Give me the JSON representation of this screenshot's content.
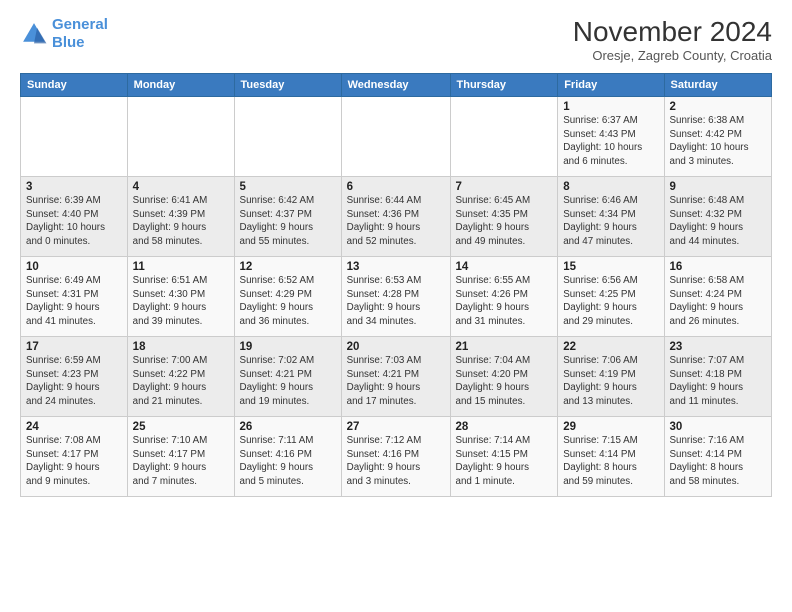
{
  "header": {
    "logo_line1": "General",
    "logo_line2": "Blue",
    "month_title": "November 2024",
    "location": "Oresje, Zagreb County, Croatia"
  },
  "columns": [
    "Sunday",
    "Monday",
    "Tuesday",
    "Wednesday",
    "Thursday",
    "Friday",
    "Saturday"
  ],
  "weeks": [
    [
      {
        "day": "",
        "info": ""
      },
      {
        "day": "",
        "info": ""
      },
      {
        "day": "",
        "info": ""
      },
      {
        "day": "",
        "info": ""
      },
      {
        "day": "",
        "info": ""
      },
      {
        "day": "1",
        "info": "Sunrise: 6:37 AM\nSunset: 4:43 PM\nDaylight: 10 hours\nand 6 minutes."
      },
      {
        "day": "2",
        "info": "Sunrise: 6:38 AM\nSunset: 4:42 PM\nDaylight: 10 hours\nand 3 minutes."
      }
    ],
    [
      {
        "day": "3",
        "info": "Sunrise: 6:39 AM\nSunset: 4:40 PM\nDaylight: 10 hours\nand 0 minutes."
      },
      {
        "day": "4",
        "info": "Sunrise: 6:41 AM\nSunset: 4:39 PM\nDaylight: 9 hours\nand 58 minutes."
      },
      {
        "day": "5",
        "info": "Sunrise: 6:42 AM\nSunset: 4:37 PM\nDaylight: 9 hours\nand 55 minutes."
      },
      {
        "day": "6",
        "info": "Sunrise: 6:44 AM\nSunset: 4:36 PM\nDaylight: 9 hours\nand 52 minutes."
      },
      {
        "day": "7",
        "info": "Sunrise: 6:45 AM\nSunset: 4:35 PM\nDaylight: 9 hours\nand 49 minutes."
      },
      {
        "day": "8",
        "info": "Sunrise: 6:46 AM\nSunset: 4:34 PM\nDaylight: 9 hours\nand 47 minutes."
      },
      {
        "day": "9",
        "info": "Sunrise: 6:48 AM\nSunset: 4:32 PM\nDaylight: 9 hours\nand 44 minutes."
      }
    ],
    [
      {
        "day": "10",
        "info": "Sunrise: 6:49 AM\nSunset: 4:31 PM\nDaylight: 9 hours\nand 41 minutes."
      },
      {
        "day": "11",
        "info": "Sunrise: 6:51 AM\nSunset: 4:30 PM\nDaylight: 9 hours\nand 39 minutes."
      },
      {
        "day": "12",
        "info": "Sunrise: 6:52 AM\nSunset: 4:29 PM\nDaylight: 9 hours\nand 36 minutes."
      },
      {
        "day": "13",
        "info": "Sunrise: 6:53 AM\nSunset: 4:28 PM\nDaylight: 9 hours\nand 34 minutes."
      },
      {
        "day": "14",
        "info": "Sunrise: 6:55 AM\nSunset: 4:26 PM\nDaylight: 9 hours\nand 31 minutes."
      },
      {
        "day": "15",
        "info": "Sunrise: 6:56 AM\nSunset: 4:25 PM\nDaylight: 9 hours\nand 29 minutes."
      },
      {
        "day": "16",
        "info": "Sunrise: 6:58 AM\nSunset: 4:24 PM\nDaylight: 9 hours\nand 26 minutes."
      }
    ],
    [
      {
        "day": "17",
        "info": "Sunrise: 6:59 AM\nSunset: 4:23 PM\nDaylight: 9 hours\nand 24 minutes."
      },
      {
        "day": "18",
        "info": "Sunrise: 7:00 AM\nSunset: 4:22 PM\nDaylight: 9 hours\nand 21 minutes."
      },
      {
        "day": "19",
        "info": "Sunrise: 7:02 AM\nSunset: 4:21 PM\nDaylight: 9 hours\nand 19 minutes."
      },
      {
        "day": "20",
        "info": "Sunrise: 7:03 AM\nSunset: 4:21 PM\nDaylight: 9 hours\nand 17 minutes."
      },
      {
        "day": "21",
        "info": "Sunrise: 7:04 AM\nSunset: 4:20 PM\nDaylight: 9 hours\nand 15 minutes."
      },
      {
        "day": "22",
        "info": "Sunrise: 7:06 AM\nSunset: 4:19 PM\nDaylight: 9 hours\nand 13 minutes."
      },
      {
        "day": "23",
        "info": "Sunrise: 7:07 AM\nSunset: 4:18 PM\nDaylight: 9 hours\nand 11 minutes."
      }
    ],
    [
      {
        "day": "24",
        "info": "Sunrise: 7:08 AM\nSunset: 4:17 PM\nDaylight: 9 hours\nand 9 minutes."
      },
      {
        "day": "25",
        "info": "Sunrise: 7:10 AM\nSunset: 4:17 PM\nDaylight: 9 hours\nand 7 minutes."
      },
      {
        "day": "26",
        "info": "Sunrise: 7:11 AM\nSunset: 4:16 PM\nDaylight: 9 hours\nand 5 minutes."
      },
      {
        "day": "27",
        "info": "Sunrise: 7:12 AM\nSunset: 4:16 PM\nDaylight: 9 hours\nand 3 minutes."
      },
      {
        "day": "28",
        "info": "Sunrise: 7:14 AM\nSunset: 4:15 PM\nDaylight: 9 hours\nand 1 minute."
      },
      {
        "day": "29",
        "info": "Sunrise: 7:15 AM\nSunset: 4:14 PM\nDaylight: 8 hours\nand 59 minutes."
      },
      {
        "day": "30",
        "info": "Sunrise: 7:16 AM\nSunset: 4:14 PM\nDaylight: 8 hours\nand 58 minutes."
      }
    ]
  ]
}
